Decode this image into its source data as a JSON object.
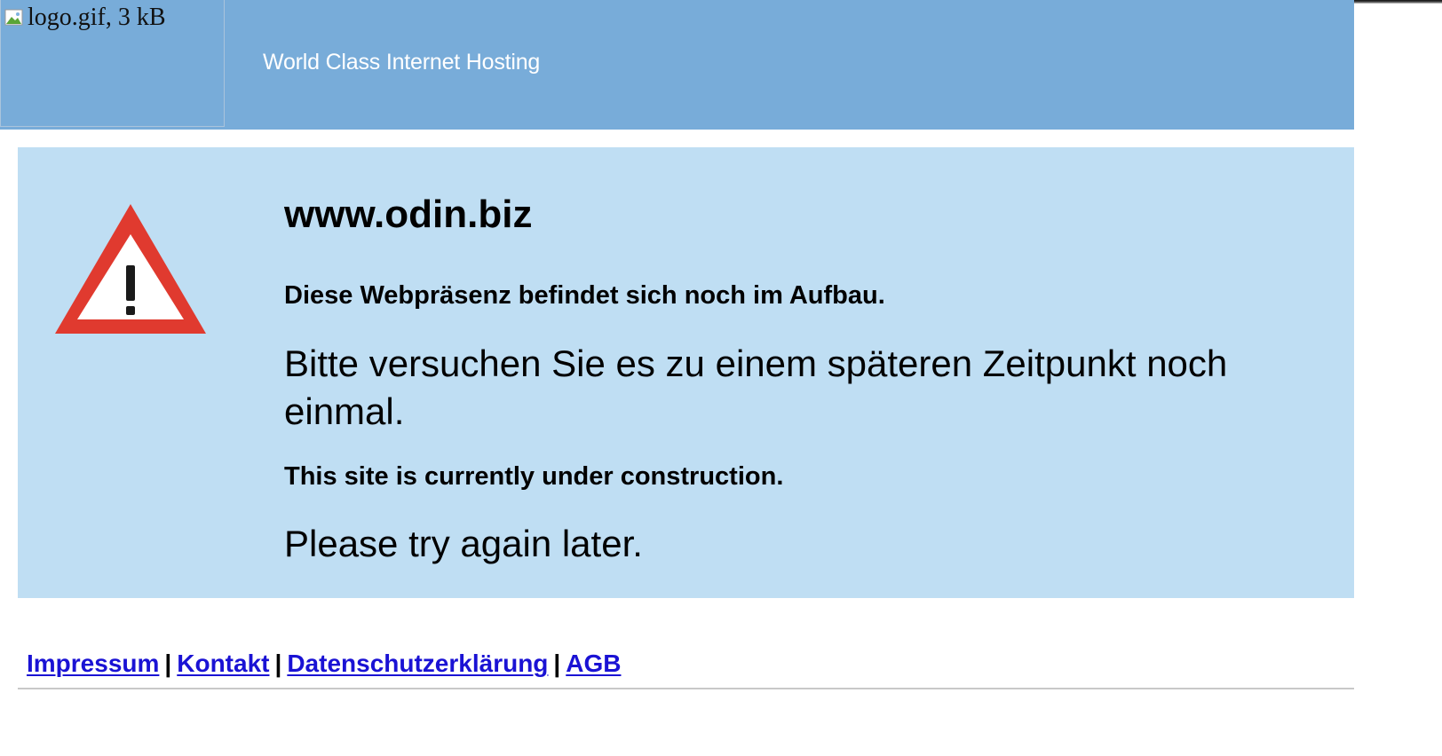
{
  "header": {
    "logo_alt": "logo.gif, 3 kB",
    "tagline": "World Class Internet Hosting"
  },
  "notice": {
    "domain": "www.odin.biz",
    "german_title": "Diese Webpräsenz befindet sich noch im Aufbau.",
    "german_message": "Bitte versuchen Sie es zu einem späteren Zeitpunkt noch einmal.",
    "english_title": "This site is currently under construction.",
    "english_message": "Please try again later.",
    "icon": "warning-triangle-icon"
  },
  "footer": {
    "links": [
      {
        "label": "Impressum"
      },
      {
        "label": "Kontakt"
      },
      {
        "label": "Datenschutzerklärung"
      },
      {
        "label": "AGB"
      }
    ],
    "separator": "|"
  },
  "colors": {
    "header_bg": "#78acd9",
    "panel_bg": "#bfdef3",
    "link": "#1a12d4",
    "warning_red": "#e03a2f"
  }
}
